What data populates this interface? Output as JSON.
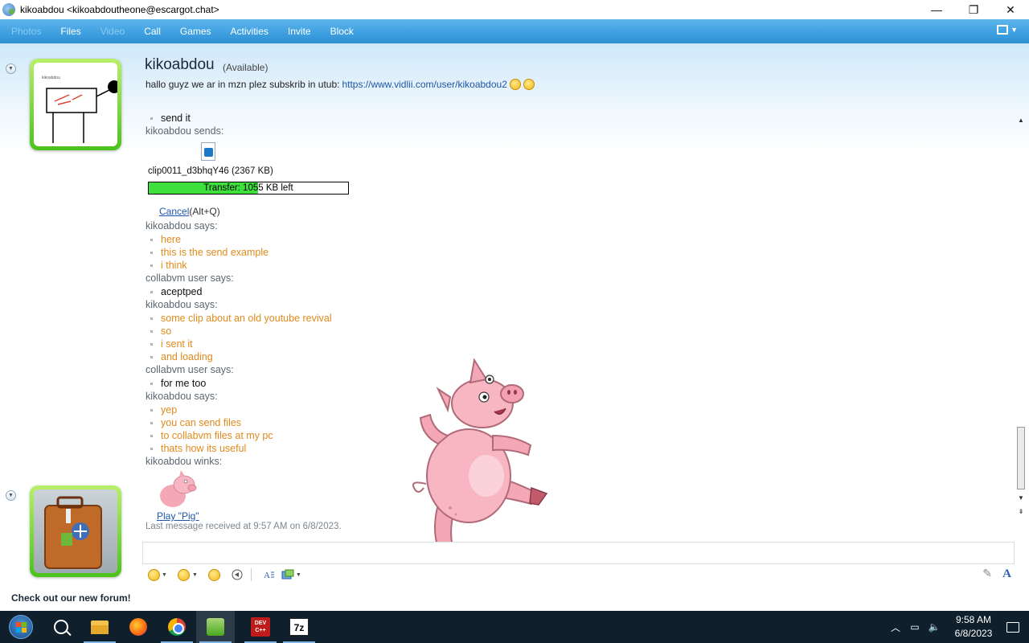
{
  "window": {
    "title": "kikoabdou <kikoabdoutheone@escargot.chat>",
    "minimize": "—",
    "restore": "❐",
    "close": "✕"
  },
  "toolbar": {
    "items": [
      {
        "label": "Photos",
        "enabled": false
      },
      {
        "label": "Files",
        "enabled": true
      },
      {
        "label": "Video",
        "enabled": false
      },
      {
        "label": "Call",
        "enabled": true
      },
      {
        "label": "Games",
        "enabled": true
      },
      {
        "label": "Activities",
        "enabled": true
      },
      {
        "label": "Invite",
        "enabled": true
      },
      {
        "label": "Block",
        "enabled": true
      }
    ]
  },
  "contact": {
    "name": "kikoabdou",
    "status": "(Available)",
    "personal_message": "hallo guyz we ar in mzn plez subskrib in utub:",
    "link": "https://www.vidlii.com/user/kikoabdou2",
    "avatar_caption": "kikoabdou"
  },
  "conversation": {
    "top_line": "send it",
    "file_sender": "kikoabdou sends:",
    "file_name": "clip0011_d3bhqY46 (2367 KB)",
    "transfer_text": "Transfer: 1055 KB left",
    "transfer_progress": 0.55,
    "cancel_label": "Cancel",
    "cancel_shortcut": "(Alt+Q)",
    "blocks": [
      {
        "sender": "kikoabdou says:",
        "mine": true,
        "lines": [
          "here",
          "this is the send example",
          "i think"
        ]
      },
      {
        "sender": "collabvm user says:",
        "mine": false,
        "lines": [
          "aceptped"
        ]
      },
      {
        "sender": "kikoabdou says:",
        "mine": true,
        "lines": [
          "some clip about an old youtube revival",
          "so",
          "i sent it",
          "and loading"
        ]
      },
      {
        "sender": "collabvm user says:",
        "mine": false,
        "lines": [
          "for me too"
        ]
      },
      {
        "sender": "kikoabdou says:",
        "mine": true,
        "lines": [
          "yep",
          "you can send files",
          "to collabvm files at my pc",
          "thats how its useful"
        ]
      }
    ],
    "wink_sender": "kikoabdou winks:",
    "wink_play": "Play \"Pig\"",
    "last_message": "Last message received at 9:57 AM on 6/8/2023."
  },
  "footer": {
    "forum_ad": "Check out our new forum!"
  },
  "taskbar": {
    "time": "9:58 AM",
    "date": "6/8/2023",
    "devcpp_label": "DEV C++",
    "sevenzip_label": "7z"
  }
}
